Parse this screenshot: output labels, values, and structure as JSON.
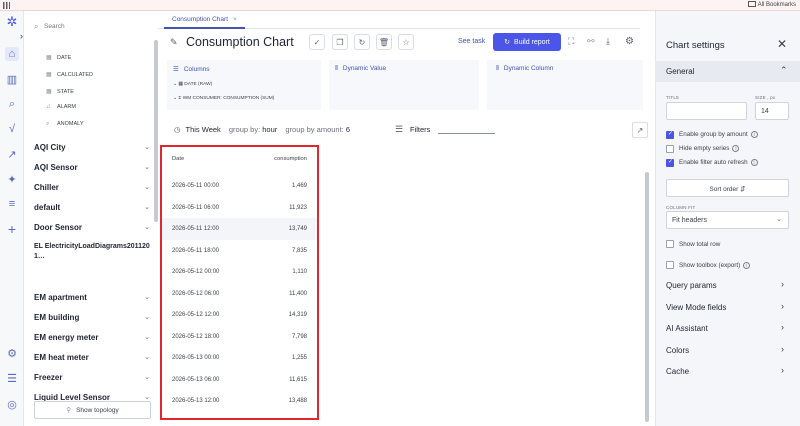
{
  "browser": {
    "bookmarks_label": "All Bookmarks"
  },
  "rail": {
    "icons": [
      "logo-icon",
      "home-icon",
      "chart-icon",
      "search-icon",
      "function-icon",
      "trend-icon",
      "sparkle-icon",
      "menu-icon",
      "plus-icon",
      "settings-icon",
      "sliders-icon",
      "user-icon"
    ]
  },
  "panel": {
    "search_placeholder": "Search",
    "tree": [
      {
        "label": "DATE",
        "icon": "table-icon"
      },
      {
        "label": "CALCULATED",
        "icon": "table-icon"
      },
      {
        "label": "STATE",
        "icon": "table-icon"
      },
      {
        "label": "ALARM",
        "icon": "bell-icon"
      },
      {
        "label": "ANOMALY",
        "icon": "search-icon"
      }
    ],
    "groups": [
      "AQI City",
      "AQI Sensor",
      "Chiller",
      "default",
      "Door Sensor",
      "EL ElectricityLoadDiagrams2011201…",
      "EM apartment",
      "EM building",
      "EM energy meter",
      "EM heat meter",
      "Freezer",
      "Liquid Level Sensor"
    ],
    "show_topology": "Show topology"
  },
  "tab": {
    "label": "Consumption Chart"
  },
  "toolbar": {
    "title": "Consumption Chart",
    "see_task": "See task",
    "build_report": "Build report"
  },
  "columns": {
    "header": "Columns",
    "items": [
      "DATE (RAW)",
      "WM CONSUMER: CONSUMPTION (SUM)"
    ],
    "dynamic_value": "Dynamic Value",
    "dynamic_column": "Dynamic Column"
  },
  "filters": {
    "period": "This Week",
    "group_by_label": "group by:",
    "group_by_value": "hour",
    "group_amount_label": "group by amount:",
    "group_amount_value": "6",
    "filters_label": "Filters"
  },
  "table": {
    "col_date": "Date",
    "col_value": "consumption",
    "rows": [
      {
        "date": "2026-05-11 00:00",
        "value": "1,469"
      },
      {
        "date": "2026-05-11 06:00",
        "value": "11,923"
      },
      {
        "date": "2026-05-11 12:00",
        "value": "13,749"
      },
      {
        "date": "2026-05-11 18:00",
        "value": "7,835"
      },
      {
        "date": "2026-05-12 00:00",
        "value": "1,110"
      },
      {
        "date": "2026-05-12 06:00",
        "value": "11,400"
      },
      {
        "date": "2026-05-12 12:00",
        "value": "14,319"
      },
      {
        "date": "2026-05-12 18:00",
        "value": "7,798"
      },
      {
        "date": "2026-05-13 00:00",
        "value": "1,255"
      },
      {
        "date": "2026-05-13 06:00",
        "value": "11,615"
      },
      {
        "date": "2026-05-13 12:00",
        "value": "13,488"
      }
    ]
  },
  "settings": {
    "title": "Chart settings",
    "general": "General",
    "title_label": "TITLE",
    "size_label": "SIZE , px",
    "size_value": "14",
    "enable_group_by_amount": "Enable group by amount",
    "hide_empty_series": "Hide empty series",
    "enable_filter_auto_refresh": "Enable filter auto refresh",
    "sort_order": "Sort order",
    "column_fit_label": "COLUMN FIT",
    "column_fit_value": "Fit headers",
    "show_total_row": "Show total row",
    "show_toolbox": "Show toolbox (export)",
    "sections": [
      "Query params",
      "View Mode fields",
      "AI Assistant",
      "Colors",
      "Cache"
    ]
  },
  "colors": {
    "accent": "#4b55e8",
    "highlight": "#e0262f"
  }
}
